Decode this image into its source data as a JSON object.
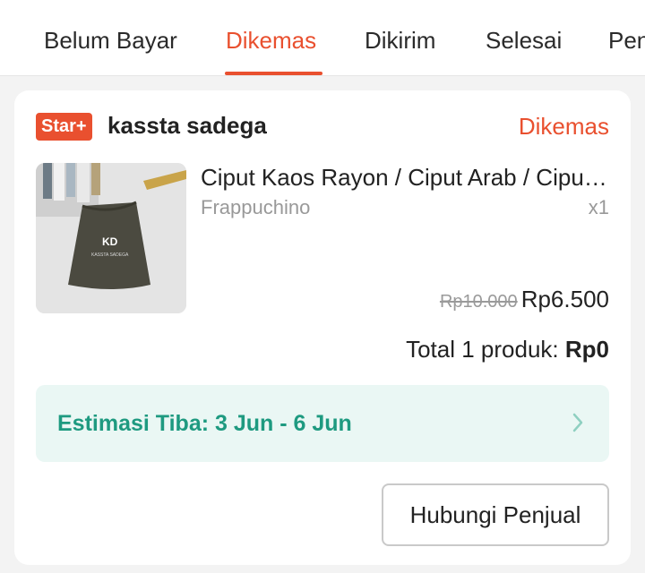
{
  "tabs": [
    {
      "label": "Belum Bayar"
    },
    {
      "label": "Dikemas"
    },
    {
      "label": "Dikirim"
    },
    {
      "label": "Selesai"
    },
    {
      "label": "Pen"
    }
  ],
  "active_tab": "Dikemas",
  "colors": {
    "accent": "#e9502f",
    "eta_text": "#1e9a80",
    "eta_bg": "#eaf7f4"
  },
  "order": {
    "badge": "Star+",
    "shop_name": "kassta sadega",
    "status": "Dikemas",
    "product": {
      "title": "Ciput Kaos Rayon / Ciput Arab / Ciput Instan",
      "variant": "Frappuchino",
      "quantity": "x1",
      "original_price": "Rp10.000",
      "price": "Rp6.500",
      "image_label": "KASSTA SADEGA"
    },
    "total_label": "Total 1 produk: ",
    "total_value": "Rp0",
    "eta": "Estimasi Tiba: 3 Jun - 6 Jun",
    "contact_button": "Hubungi Penjual"
  }
}
